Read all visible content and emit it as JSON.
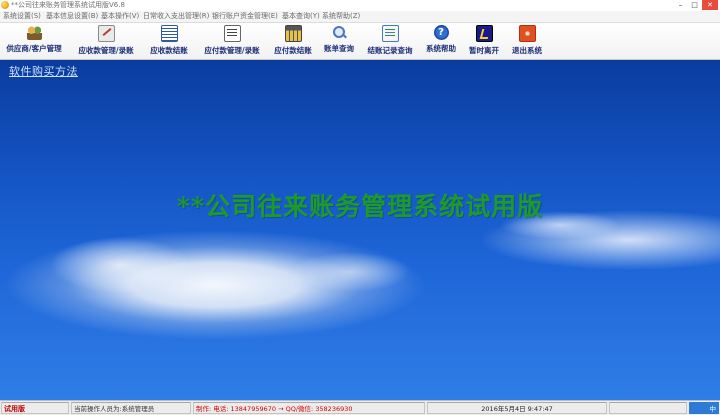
{
  "window": {
    "title": "**公司往来账务管理系统试用版V6.8",
    "minimize": "–",
    "maximize": "□",
    "close": "✕"
  },
  "menu": [
    "系统设置(S)",
    "基本信息设置(B)",
    "基本操作(V)",
    "日常收入支出管理(R)",
    "银行账户资金管理(E)",
    "基本查询(Y)",
    "系统帮助(Z)"
  ],
  "toolbar": [
    {
      "label": "供应商/客户管理",
      "icon": "users-icon"
    },
    {
      "label": "应收款管理/录账",
      "icon": "edit-icon"
    },
    {
      "label": "应收款结账",
      "icon": "grid-icon"
    },
    {
      "label": "应付款管理/录账",
      "icon": "form-icon"
    },
    {
      "label": "应付款结账",
      "icon": "calculator-icon"
    },
    {
      "label": "账单查询",
      "icon": "magnifier-icon"
    },
    {
      "label": "结账记录查询",
      "icon": "record-icon"
    },
    {
      "label": "系统帮助",
      "icon": "help-icon"
    },
    {
      "label": "暂时离开",
      "icon": "leave-icon"
    },
    {
      "label": "退出系统",
      "icon": "exit-icon"
    }
  ],
  "main": {
    "buy_link": "软件购买方法",
    "banner": "**公司往来账务管理系统试用版"
  },
  "status": {
    "trial": "试用版",
    "operator": "当前操作人员为:系统管理员",
    "contact": "QQ/微信: 358236930",
    "contact_prefix": "制作: 电话: 13847959670 →",
    "date": "2016年5月4日  9:47:47",
    "ime": "中"
  },
  "colors": {
    "banner_text": "#1e9a2c",
    "toolbar_label": "#1f2f7a",
    "trial_text": "#c00000"
  }
}
